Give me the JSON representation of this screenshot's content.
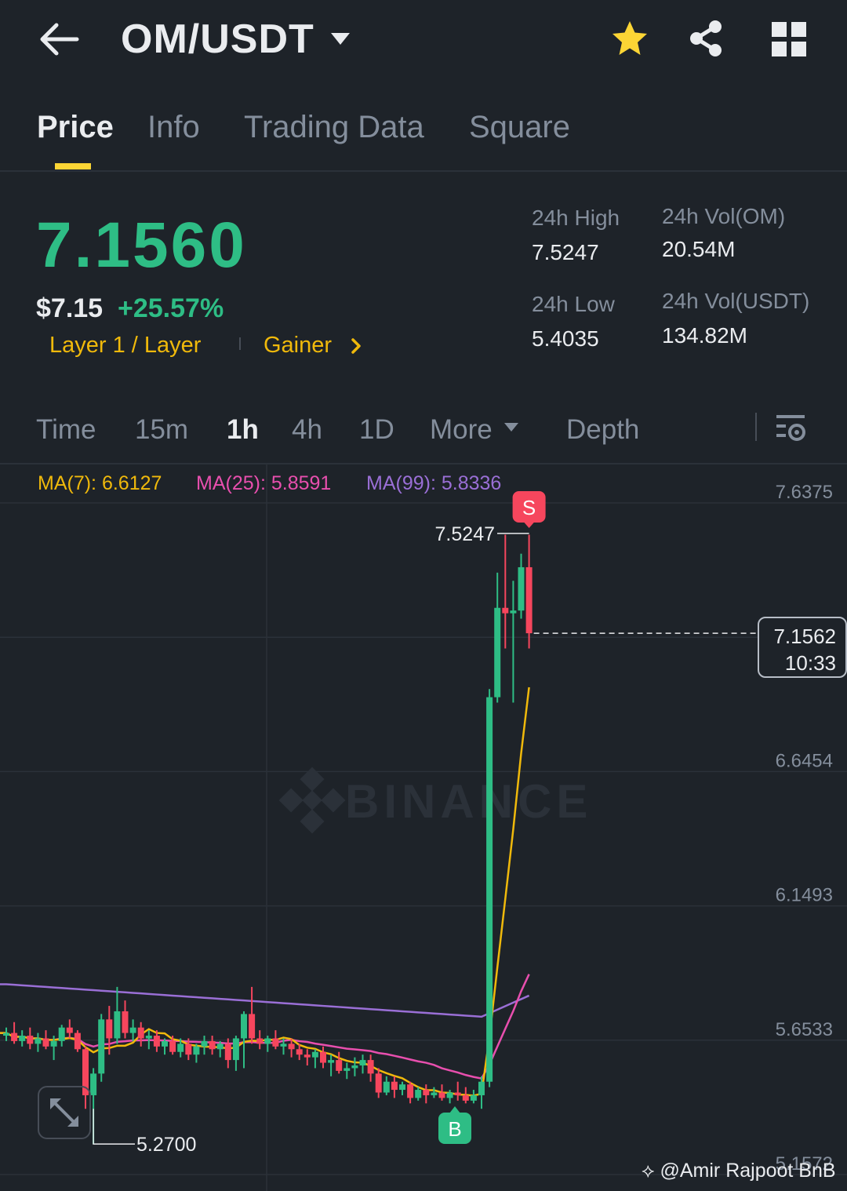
{
  "header": {
    "pair": "OM/USDT",
    "icons": [
      "back-arrow-icon",
      "chevron-down-icon",
      "star-icon",
      "share-icon",
      "grid-icon"
    ],
    "favorite_color": "#fcd535"
  },
  "tabs": [
    {
      "label": "Price",
      "active": true
    },
    {
      "label": "Info",
      "active": false
    },
    {
      "label": "Trading Data",
      "active": false
    },
    {
      "label": "Square",
      "active": false
    }
  ],
  "price": {
    "last": "7.1560",
    "fiat": "$7.15",
    "change": "+25.57%",
    "tag_sector": "Layer 1 / Layer",
    "tag_rank": "Gainer",
    "up_color": "#2ebd85",
    "down_color": "#f6465d"
  },
  "stats": {
    "high_label": "24h High",
    "high_value": "7.5247",
    "low_label": "24h Low",
    "low_value": "5.4035",
    "vol_base_label": "24h Vol(OM)",
    "vol_base_value": "20.54M",
    "vol_quote_label": "24h Vol(USDT)",
    "vol_quote_value": "134.82M"
  },
  "intervals": {
    "items": [
      "Time",
      "15m",
      "1h",
      "4h",
      "1D",
      "More"
    ],
    "active": "1h",
    "depth": "Depth"
  },
  "ma_legend": {
    "ma7": "MA(7): 6.6127",
    "ma7_color": "#f0b90b",
    "ma25": "MA(25): 5.8591",
    "ma25_color": "#e84fae",
    "ma99": "MA(99): 5.8336",
    "ma99_color": "#9a6fd6"
  },
  "chart": {
    "y_ticks": [
      "7.6375",
      "6.6454",
      "6.1493",
      "5.6533",
      "5.1572"
    ],
    "current_price": "7.1562",
    "current_time": "10:33",
    "high_marker": "7.5247",
    "low_marker": "5.2700",
    "sell_marker": "S",
    "buy_marker": "B",
    "watermark": "BINANCE",
    "credit": "@Amir Rajpoot BnB"
  },
  "chart_data": {
    "type": "candlestick",
    "interval": "1h",
    "y_ticks": [
      7.6375,
      7.1414,
      6.6454,
      6.1493,
      5.6533,
      5.1572
    ],
    "ylim": [
      5.1572,
      7.6375
    ],
    "candles": [
      [
        5.67,
        5.7,
        5.65,
        5.68
      ],
      [
        5.68,
        5.72,
        5.64,
        5.65
      ],
      [
        5.65,
        5.69,
        5.63,
        5.67
      ],
      [
        5.67,
        5.7,
        5.62,
        5.64
      ],
      [
        5.64,
        5.68,
        5.61,
        5.66
      ],
      [
        5.66,
        5.69,
        5.62,
        5.63
      ],
      [
        5.63,
        5.67,
        5.58,
        5.65
      ],
      [
        5.65,
        5.71,
        5.63,
        5.7
      ],
      [
        5.7,
        5.73,
        5.66,
        5.68
      ],
      [
        5.68,
        5.69,
        5.61,
        5.62
      ],
      [
        5.62,
        5.63,
        5.4,
        5.45
      ],
      [
        5.45,
        5.55,
        5.27,
        5.53
      ],
      [
        5.53,
        5.75,
        5.5,
        5.73
      ],
      [
        5.73,
        5.78,
        5.6,
        5.66
      ],
      [
        5.66,
        5.85,
        5.64,
        5.76
      ],
      [
        5.76,
        5.8,
        5.66,
        5.68
      ],
      [
        5.68,
        5.73,
        5.65,
        5.7
      ],
      [
        5.7,
        5.72,
        5.63,
        5.66
      ],
      [
        5.66,
        5.69,
        5.62,
        5.67
      ],
      [
        5.67,
        5.69,
        5.61,
        5.63
      ],
      [
        5.63,
        5.66,
        5.6,
        5.65
      ],
      [
        5.65,
        5.67,
        5.6,
        5.61
      ],
      [
        5.61,
        5.66,
        5.59,
        5.64
      ],
      [
        5.64,
        5.66,
        5.58,
        5.6
      ],
      [
        5.6,
        5.64,
        5.57,
        5.63
      ],
      [
        5.63,
        5.67,
        5.6,
        5.65
      ],
      [
        5.65,
        5.67,
        5.6,
        5.62
      ],
      [
        5.62,
        5.65,
        5.59,
        5.64
      ],
      [
        5.64,
        5.66,
        5.55,
        5.58
      ],
      [
        5.58,
        5.67,
        5.54,
        5.66
      ],
      [
        5.66,
        5.76,
        5.55,
        5.75
      ],
      [
        5.75,
        5.85,
        5.64,
        5.66
      ],
      [
        5.66,
        5.69,
        5.62,
        5.64
      ],
      [
        5.64,
        5.67,
        5.61,
        5.66
      ],
      [
        5.66,
        5.69,
        5.62,
        5.63
      ],
      [
        5.63,
        5.66,
        5.6,
        5.64
      ],
      [
        5.64,
        5.66,
        5.59,
        5.62
      ],
      [
        5.62,
        5.64,
        5.58,
        5.6
      ],
      [
        5.6,
        5.62,
        5.56,
        5.59
      ],
      [
        5.59,
        5.62,
        5.55,
        5.61
      ],
      [
        5.61,
        5.63,
        5.55,
        5.57
      ],
      [
        5.57,
        5.6,
        5.52,
        5.58
      ],
      [
        5.58,
        5.61,
        5.53,
        5.54
      ],
      [
        5.54,
        5.57,
        5.51,
        5.55
      ],
      [
        5.55,
        5.59,
        5.52,
        5.56
      ],
      [
        5.56,
        5.6,
        5.53,
        5.58
      ],
      [
        5.58,
        5.6,
        5.5,
        5.53
      ],
      [
        5.53,
        5.55,
        5.44,
        5.46
      ],
      [
        5.46,
        5.52,
        5.45,
        5.5
      ],
      [
        5.5,
        5.52,
        5.44,
        5.47
      ],
      [
        5.47,
        5.5,
        5.45,
        5.49
      ],
      [
        5.49,
        5.5,
        5.42,
        5.44
      ],
      [
        5.44,
        5.48,
        5.43,
        5.47
      ],
      [
        5.47,
        5.49,
        5.42,
        5.45
      ],
      [
        5.45,
        5.48,
        5.44,
        5.46
      ],
      [
        5.46,
        5.49,
        5.43,
        5.44
      ],
      [
        5.44,
        5.47,
        5.42,
        5.46
      ],
      [
        5.46,
        5.5,
        5.43,
        5.45
      ],
      [
        5.45,
        5.48,
        5.42,
        5.43
      ],
      [
        5.43,
        5.47,
        5.42,
        5.45
      ],
      [
        5.45,
        5.52,
        5.4,
        5.5
      ],
      [
        5.5,
        6.95,
        5.48,
        6.92
      ],
      [
        6.92,
        7.38,
        6.9,
        7.25
      ],
      [
        7.25,
        7.52,
        7.1,
        7.23
      ],
      [
        7.23,
        7.35,
        6.9,
        7.24
      ],
      [
        7.24,
        7.45,
        7.21,
        7.4
      ],
      [
        7.4,
        7.52,
        7.1,
        7.1562
      ]
    ],
    "ma7_last": 6.6127,
    "ma25_last": 5.8591,
    "ma99_last": 5.8336,
    "high_marker": 7.5247,
    "low_marker": 5.27,
    "current_price": 7.1562
  }
}
